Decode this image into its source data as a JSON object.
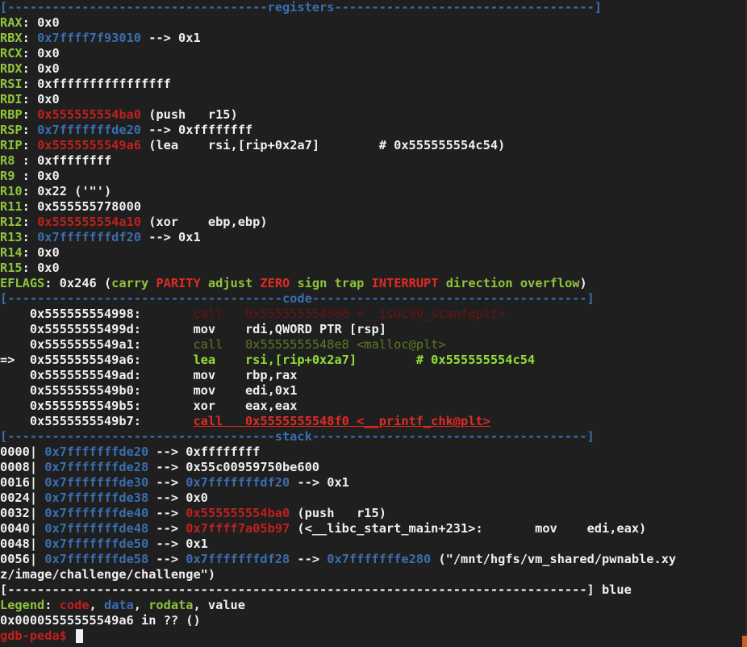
{
  "sections": {
    "registers_header": "[-----------------------------------registers-----------------------------------]",
    "code_header": "[-------------------------------------code-------------------------------------]",
    "stack_header": "[------------------------------------stack-------------------------------------]",
    "end_header": "[------------------------------------------------------------------------------]",
    "end_word": " blue"
  },
  "registers": [
    {
      "name": "RAX",
      "sep": ": ",
      "parts": [
        {
          "t": "0x0",
          "k": "w"
        }
      ]
    },
    {
      "name": "RBX",
      "sep": ": ",
      "parts": [
        {
          "t": "0x7ffff7f93010",
          "k": "c"
        },
        {
          "t": " --> 0x1",
          "k": "w"
        }
      ]
    },
    {
      "name": "RCX",
      "sep": ": ",
      "parts": [
        {
          "t": "0x0",
          "k": "w"
        }
      ]
    },
    {
      "name": "RDX",
      "sep": ": ",
      "parts": [
        {
          "t": "0x0",
          "k": "w"
        }
      ]
    },
    {
      "name": "RSI",
      "sep": ": ",
      "parts": [
        {
          "t": "0xffffffffffffffff",
          "k": "w"
        }
      ]
    },
    {
      "name": "RDI",
      "sep": ": ",
      "parts": [
        {
          "t": "0x0",
          "k": "w"
        }
      ]
    },
    {
      "name": "RBP",
      "sep": ": ",
      "parts": [
        {
          "t": "0x555555554ba0",
          "k": "r"
        },
        {
          "t": " (push   r15)",
          "k": "w"
        }
      ]
    },
    {
      "name": "RSP",
      "sep": ": ",
      "parts": [
        {
          "t": "0x7fffffffde20",
          "k": "c"
        },
        {
          "t": " --> 0xffffffff",
          "k": "w"
        }
      ]
    },
    {
      "name": "RIP",
      "sep": ": ",
      "parts": [
        {
          "t": "0x5555555549a6",
          "k": "r"
        },
        {
          "t": " (lea    rsi,[rip+0x2a7]        # 0x555555554c54)",
          "k": "w"
        }
      ]
    },
    {
      "name": "R8",
      "sep": " : ",
      "parts": [
        {
          "t": "0xffffffff",
          "k": "w"
        }
      ]
    },
    {
      "name": "R9",
      "sep": " : ",
      "parts": [
        {
          "t": "0x0",
          "k": "w"
        }
      ]
    },
    {
      "name": "R10",
      "sep": ": ",
      "parts": [
        {
          "t": "0x22 ('\"')",
          "k": "w"
        }
      ]
    },
    {
      "name": "R11",
      "sep": ": ",
      "parts": [
        {
          "t": "0x555555778000",
          "k": "w"
        }
      ]
    },
    {
      "name": "R12",
      "sep": ": ",
      "parts": [
        {
          "t": "0x555555554a10",
          "k": "r"
        },
        {
          "t": " (xor    ebp,ebp)",
          "k": "w"
        }
      ]
    },
    {
      "name": "R13",
      "sep": ": ",
      "parts": [
        {
          "t": "0x7fffffffdf20",
          "k": "c"
        },
        {
          "t": " --> 0x1",
          "k": "w"
        }
      ]
    },
    {
      "name": "R14",
      "sep": ": ",
      "parts": [
        {
          "t": "0x0",
          "k": "w"
        }
      ]
    },
    {
      "name": "R15",
      "sep": ": ",
      "parts": [
        {
          "t": "0x0",
          "k": "w"
        }
      ]
    }
  ],
  "eflags": {
    "name": "EFLAGS",
    "value": ": 0x246 (",
    "flags": [
      {
        "t": "carry",
        "on": false
      },
      {
        "t": "PARITY",
        "on": true
      },
      {
        "t": "adjust",
        "on": false
      },
      {
        "t": "ZERO",
        "on": true
      },
      {
        "t": "sign",
        "on": false
      },
      {
        "t": "trap",
        "on": false
      },
      {
        "t": "INTERRUPT",
        "on": true
      },
      {
        "t": "direction",
        "on": false
      },
      {
        "t": "overflow",
        "on": false
      }
    ],
    "close": ")"
  },
  "code": [
    {
      "marker": "   ",
      "addr": "0x555555554998:",
      "mnem": "call",
      "ops": "0x555555554900 <__isoc99_scanf@plt>",
      "style": "dim"
    },
    {
      "marker": "   ",
      "addr": "0x55555555499d:",
      "mnem": "mov",
      "ops": "rdi,QWORD PTR [rsp]",
      "style": "normal"
    },
    {
      "marker": "   ",
      "addr": "0x5555555549a1:",
      "mnem": "call",
      "ops": "0x5555555548e8 <malloc@plt>",
      "style": "dimg"
    },
    {
      "marker": "=> ",
      "addr": "0x5555555549a6:",
      "mnem": "lea",
      "ops": "rsi,[rip+0x2a7]        # 0x555555554c54",
      "style": "current"
    },
    {
      "marker": "   ",
      "addr": "0x5555555549ad:",
      "mnem": "mov",
      "ops": "rbp,rax",
      "style": "normal"
    },
    {
      "marker": "   ",
      "addr": "0x5555555549b0:",
      "mnem": "mov",
      "ops": "edi,0x1",
      "style": "normal"
    },
    {
      "marker": "   ",
      "addr": "0x5555555549b5:",
      "mnem": "xor",
      "ops": "eax,eax",
      "style": "normal"
    },
    {
      "marker": "   ",
      "addr": "0x5555555549b7:",
      "mnem": "call",
      "ops": "0x5555555548f0 <__printf_chk@plt>",
      "style": "nextcall"
    }
  ],
  "stack": [
    {
      "off": "0000",
      "parts": [
        {
          "t": "0x7fffffffde20",
          "k": "c"
        },
        {
          "t": " --> 0xffffffff",
          "k": "w"
        }
      ]
    },
    {
      "off": "0008",
      "parts": [
        {
          "t": "0x7fffffffde28",
          "k": "c"
        },
        {
          "t": " --> 0x55c00959750be600",
          "k": "w"
        }
      ]
    },
    {
      "off": "0016",
      "parts": [
        {
          "t": "0x7fffffffde30",
          "k": "c"
        },
        {
          "t": " --> ",
          "k": "w"
        },
        {
          "t": "0x7fffffffdf20",
          "k": "c"
        },
        {
          "t": " --> 0x1",
          "k": "w"
        }
      ]
    },
    {
      "off": "0024",
      "parts": [
        {
          "t": "0x7fffffffde38",
          "k": "c"
        },
        {
          "t": " --> 0x0",
          "k": "w"
        }
      ]
    },
    {
      "off": "0032",
      "parts": [
        {
          "t": "0x7fffffffde40",
          "k": "c"
        },
        {
          "t": " --> ",
          "k": "w"
        },
        {
          "t": "0x555555554ba0",
          "k": "r"
        },
        {
          "t": " (push   r15)",
          "k": "w"
        }
      ]
    },
    {
      "off": "0040",
      "parts": [
        {
          "t": "0x7fffffffde48",
          "k": "c"
        },
        {
          "t": " --> ",
          "k": "w"
        },
        {
          "t": "0x7ffff7a05b97",
          "k": "r"
        },
        {
          "t": " (<__libc_start_main+231>:       mov    edi,eax)",
          "k": "w"
        }
      ]
    },
    {
      "off": "0048",
      "parts": [
        {
          "t": "0x7fffffffde50",
          "k": "c"
        },
        {
          "t": " --> 0x1",
          "k": "w"
        }
      ]
    },
    {
      "off": "0056",
      "parts": [
        {
          "t": "0x7fffffffde58",
          "k": "c"
        },
        {
          "t": " --> ",
          "k": "w"
        },
        {
          "t": "0x7fffffffdf28",
          "k": "c"
        },
        {
          "t": " --> ",
          "k": "w"
        },
        {
          "t": "0x7fffffffe280",
          "k": "c"
        },
        {
          "t": " (\"/mnt/hgfs/vm_shared/pwnable.xy",
          "k": "w"
        }
      ]
    }
  ],
  "stack_wrap": "z/image/challenge/challenge\")",
  "legend": {
    "label": "Legend",
    "sep": ": ",
    "items": [
      {
        "t": "code",
        "k": "r"
      },
      {
        "t": "data",
        "k": "c"
      },
      {
        "t": "rodata",
        "k": "g"
      },
      {
        "t": "value",
        "k": "w"
      }
    ]
  },
  "location": "0x00005555555549a6 in ?? ()",
  "prompt": "gdb-peda$ "
}
